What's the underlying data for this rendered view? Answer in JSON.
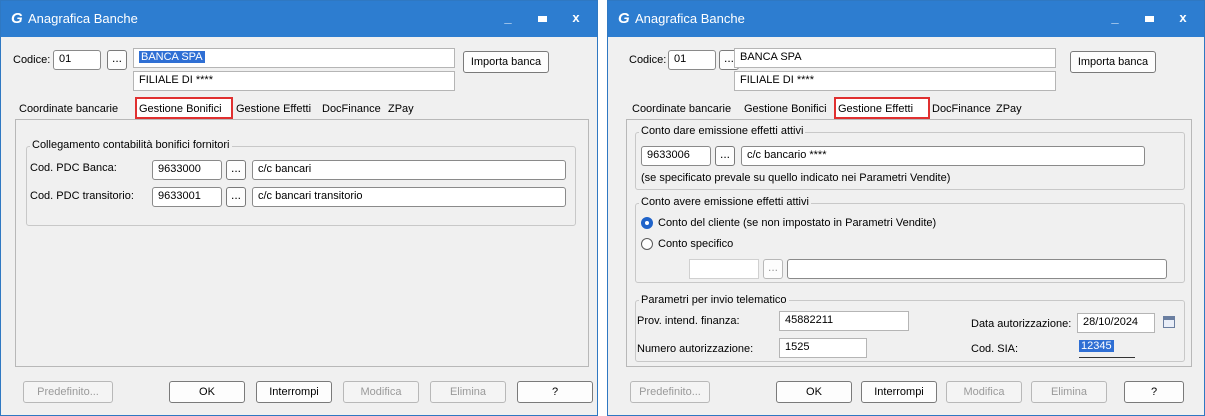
{
  "left": {
    "title": "Anagrafica Banche",
    "controls": {
      "minimize": "_",
      "close": "x"
    },
    "codice_label": "Codice:",
    "codice_value": "01",
    "browse": "...",
    "bank_name": "BANCA SPA",
    "branch": "FILIALE DI ****",
    "import_button": "Importa banca",
    "tabs": [
      "Coordinate bancarie",
      "Gestione Bonifici",
      "Gestione Effetti",
      "DocFinance",
      "ZPay"
    ],
    "group_title": "Collegamento contabilità bonifici fornitori",
    "rows": [
      {
        "label": "Cod. PDC Banca:",
        "code": "9633000",
        "desc": "c/c bancari"
      },
      {
        "label": "Cod. PDC transitorio:",
        "code": "9633001",
        "desc": "c/c bancari transitorio"
      }
    ],
    "buttons": [
      "Predefinito...",
      "OK",
      "Interrompi",
      "Modifica",
      "Elimina",
      "?"
    ]
  },
  "right": {
    "title": "Anagrafica Banche",
    "controls": {
      "minimize": "_",
      "close": "x"
    },
    "codice_label": "Codice:",
    "codice_value": "01",
    "browse": "...",
    "bank_name": "BANCA SPA",
    "branch": "FILIALE DI ****",
    "import_button": "Importa banca",
    "tabs": [
      "Coordinate bancarie",
      "Gestione Bonifici",
      "Gestione Effetti",
      "DocFinance",
      "ZPay"
    ],
    "dare": {
      "title": "Conto dare emissione effetti attivi",
      "code": "9633006",
      "desc": "c/c bancario ****",
      "note": "(se specificato prevale su quello indicato nei Parametri Vendite)"
    },
    "avere": {
      "title": "Conto avere emissione effetti attivi",
      "opt1": "Conto del cliente (se non impostato in Parametri Vendite)",
      "opt2": "Conto specifico",
      "selected": "opt1"
    },
    "telematic": {
      "title": "Parametri per invio telematico",
      "prov_label": "Prov. intend. finanza:",
      "prov_value": "45882211",
      "num_label": "Numero autorizzazione:",
      "num_value": "1525",
      "date_label": "Data autorizzazione:",
      "date_value": "28/10/2024",
      "sia_label": "Cod. SIA:",
      "sia_value": "12345"
    },
    "buttons": [
      "Predefinito...",
      "OK",
      "Interrompi",
      "Modifica",
      "Elimina",
      "?"
    ]
  },
  "colors": {
    "titlebar": "#2d7dd0",
    "highlight": "#e03030",
    "selection": "#2f6fd4"
  }
}
